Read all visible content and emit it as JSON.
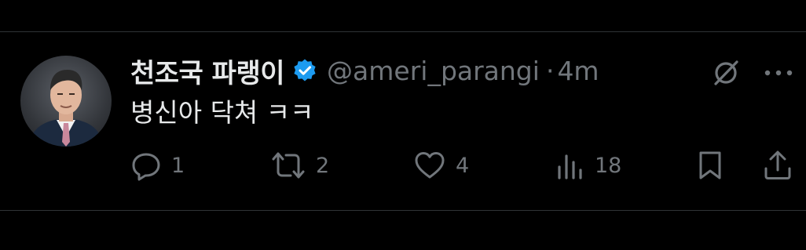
{
  "colors": {
    "background": "#000000",
    "text_primary": "#e7e9ea",
    "text_secondary": "#71767b",
    "verified_blue": "#1d9bf0",
    "divider": "#2f3336"
  },
  "tweet": {
    "display_name": "천조국 파랭이",
    "verified_icon": "verified-badge-icon",
    "handle": "@ameri_parangi",
    "separator": "·",
    "time": "4m",
    "text": "병신아 닥쳐 ㅋㅋ",
    "actions": {
      "reply": {
        "icon": "reply-icon",
        "count": "1"
      },
      "retweet": {
        "icon": "retweet-icon",
        "count": "2"
      },
      "like": {
        "icon": "heart-icon",
        "count": "4"
      },
      "views": {
        "icon": "views-icon",
        "count": "18"
      },
      "bookmark": {
        "icon": "bookmark-icon"
      },
      "share": {
        "icon": "share-icon"
      }
    },
    "top_right_icons": [
      "grok-icon",
      "more-icon"
    ]
  }
}
